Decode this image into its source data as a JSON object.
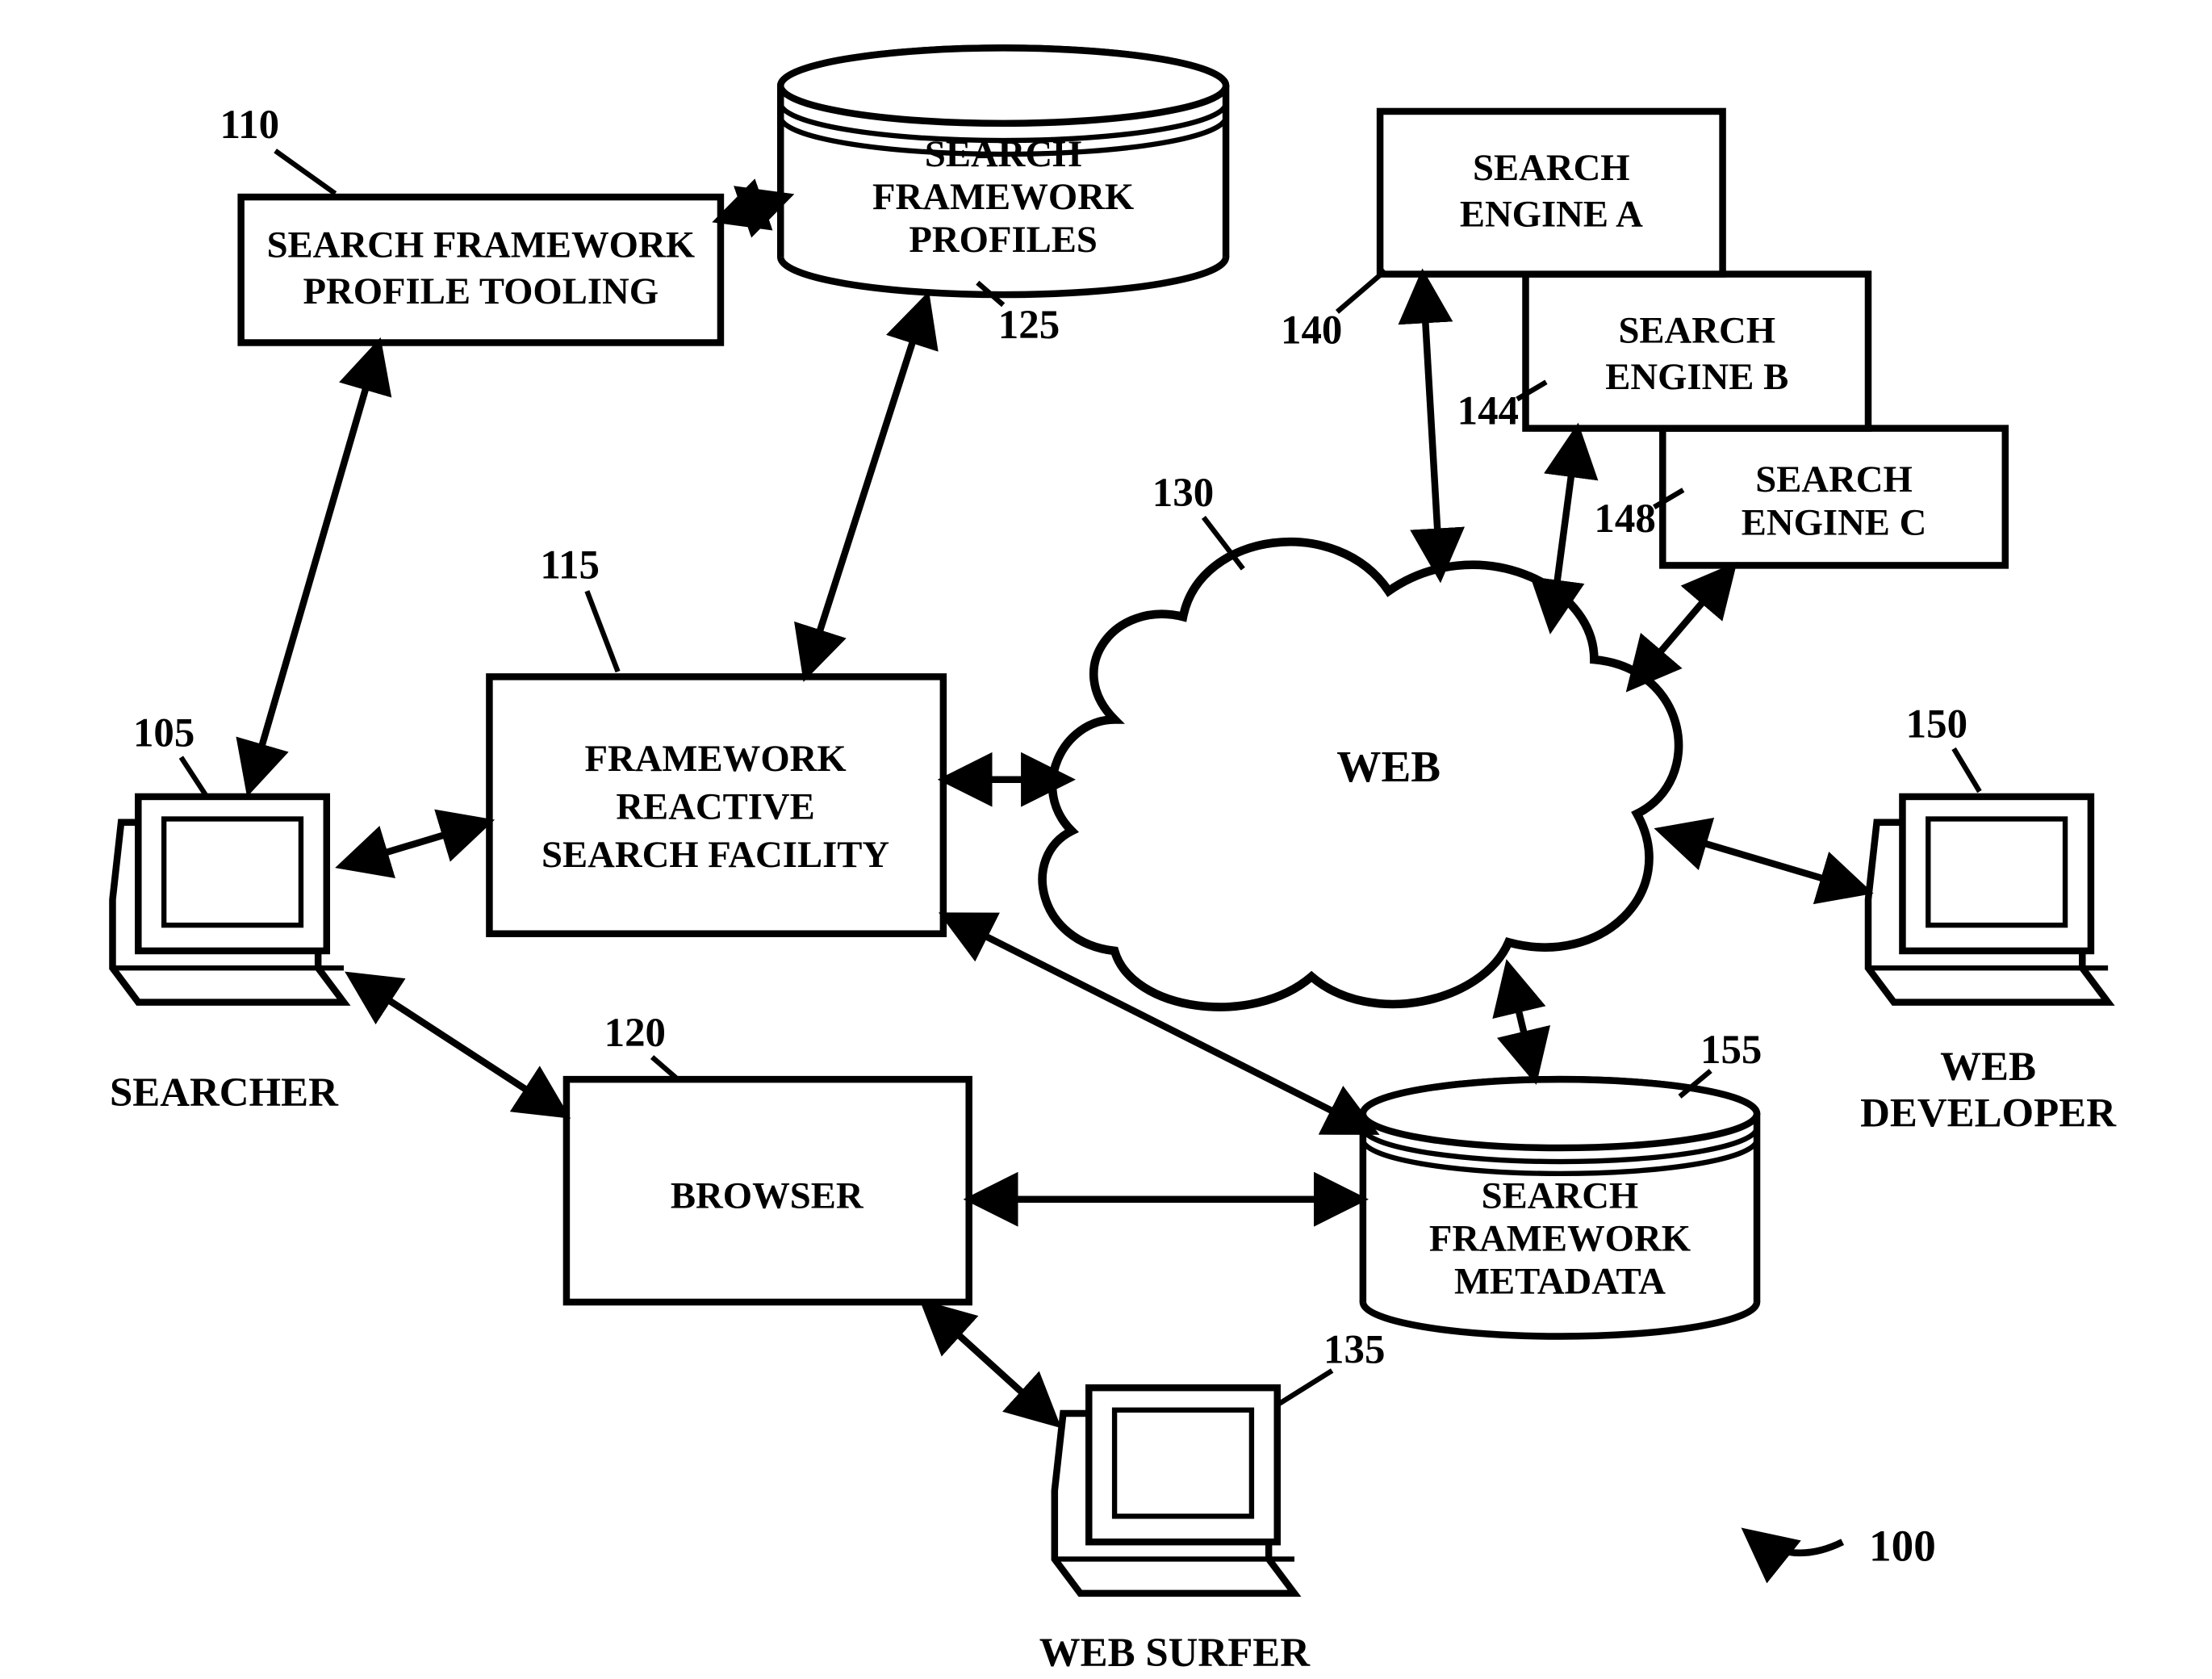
{
  "nodes": {
    "profile_tooling": {
      "ref": "110",
      "label": "SEARCH FRAMEWORK\nPROFILE TOOLING"
    },
    "profiles": {
      "ref": "125",
      "label": "SEARCH\nFRAMEWORK\nPROFILES"
    },
    "reactive_facility": {
      "ref": "115",
      "label": "FRAMEWORK\nREACTIVE\nSEARCH FACILITY"
    },
    "browser": {
      "ref": "120",
      "label": "BROWSER"
    },
    "web": {
      "ref": "130",
      "label": "WEB"
    },
    "searcher": {
      "ref": "105",
      "label": "SEARCHER"
    },
    "web_surfer": {
      "ref": "135",
      "label": "WEB SURFER"
    },
    "engine_a": {
      "ref": "140",
      "label": "SEARCH\nENGINE A"
    },
    "engine_b": {
      "ref": "144",
      "label": "SEARCH\nENGINE B"
    },
    "engine_c": {
      "ref": "148",
      "label": "SEARCH\nENGINE C"
    },
    "metadata": {
      "ref": "155",
      "label": "SEARCH\nFRAMEWORK\nMETADATA"
    },
    "developer": {
      "ref": "150",
      "label": "WEB\nDEVELOPER"
    }
  },
  "figure_ref": "100"
}
